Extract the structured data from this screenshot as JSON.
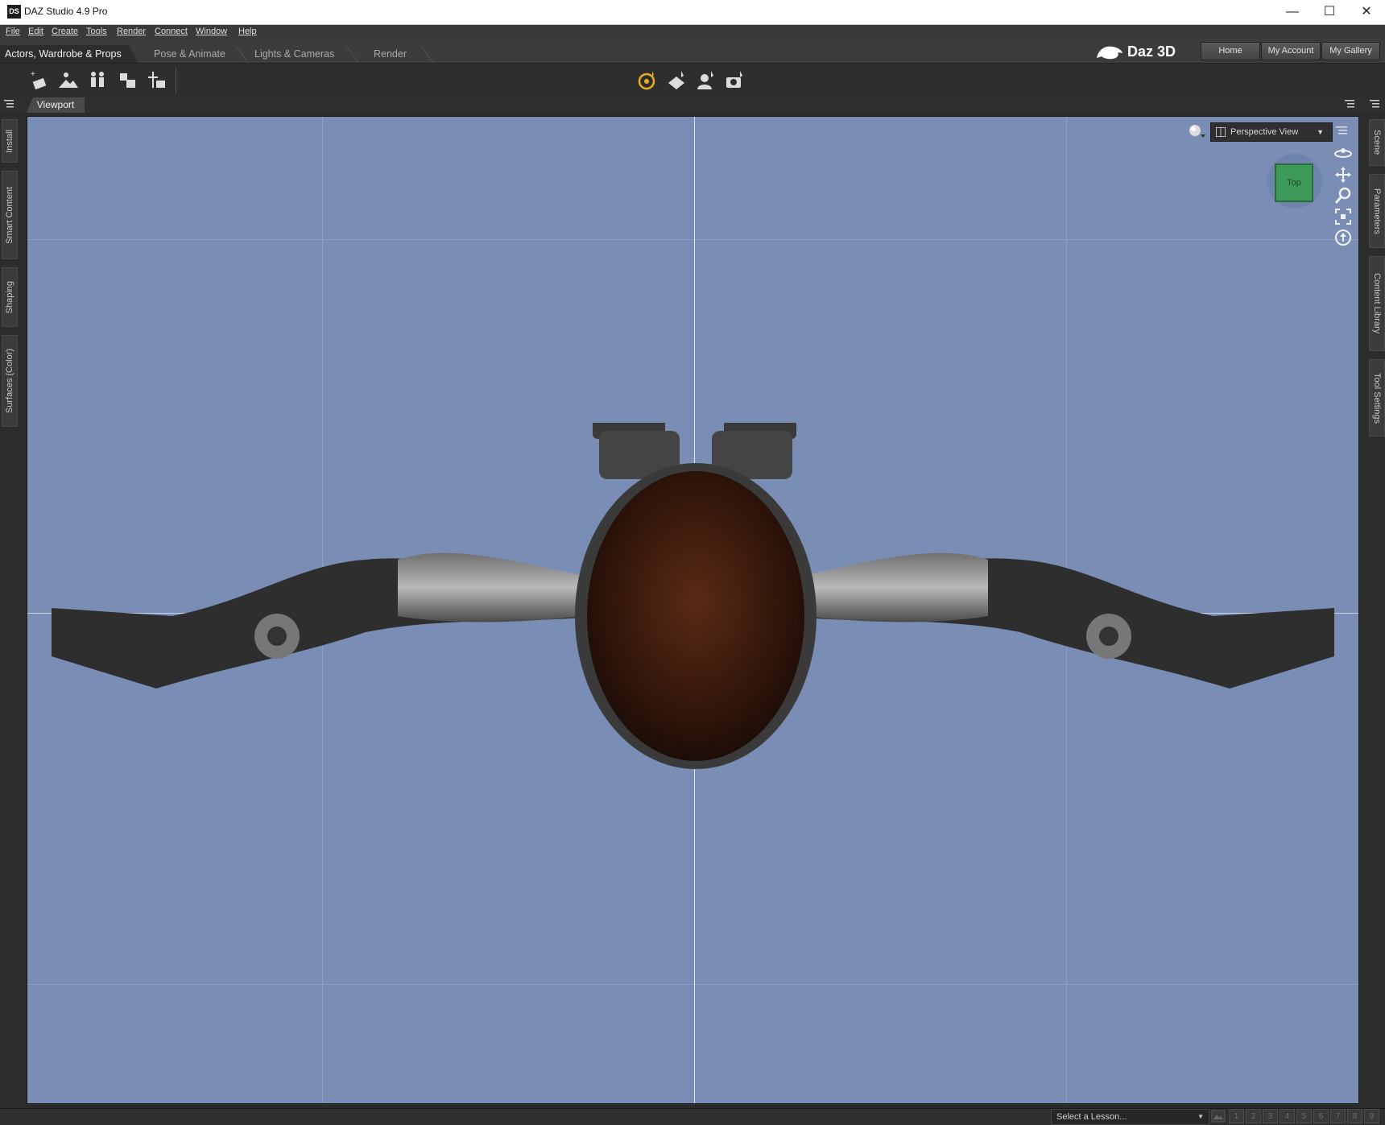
{
  "window": {
    "title": "DAZ Studio 4.9 Pro",
    "icon_text": "DS",
    "controls": [
      "—",
      "☐",
      "✕"
    ]
  },
  "menu": [
    "File",
    "Edit",
    "Create",
    "Tools",
    "Render",
    "Connect",
    "Window",
    "Help"
  ],
  "rooms": {
    "active": "Actors, Wardrobe & Props",
    "tabs": [
      "Pose & Animate",
      "Lights & Cameras",
      "Render"
    ]
  },
  "brand": {
    "logo_text": "Daz 3D"
  },
  "account_buttons": [
    "Home",
    "My Account",
    "My Gallery"
  ],
  "toolbar_icons": [
    "add-figure-icon",
    "add-environment-icon",
    "add-actors-icon",
    "add-prop-icon",
    "add-item-icon"
  ],
  "center_tool_icons": [
    "universal-tool-icon",
    "surface-selection-icon",
    "node-selection-icon",
    "camera-tool-icon"
  ],
  "viewport": {
    "tab_label": "Viewport",
    "view_select": "Perspective View",
    "cube_face": "Top",
    "nav_icons": [
      "orbit-icon",
      "pan-icon",
      "zoom-icon",
      "frame-icon",
      "reset-view-icon"
    ]
  },
  "left_panel_tabs": [
    "Install",
    "Smart Content",
    "Shaping",
    "Surfaces (Color)"
  ],
  "right_panel_tabs": [
    "Scene",
    "Parameters",
    "Content Library",
    "Tool Settings"
  ],
  "statusbar": {
    "lesson_placeholder": "Select a Lesson...",
    "steps": [
      "1",
      "2",
      "3",
      "4",
      "5",
      "6",
      "7",
      "8",
      "9"
    ]
  },
  "colors": {
    "viewport_bg": "#7a8db5",
    "accent_icon": "#e8b020",
    "cube": "#3e9a58"
  }
}
